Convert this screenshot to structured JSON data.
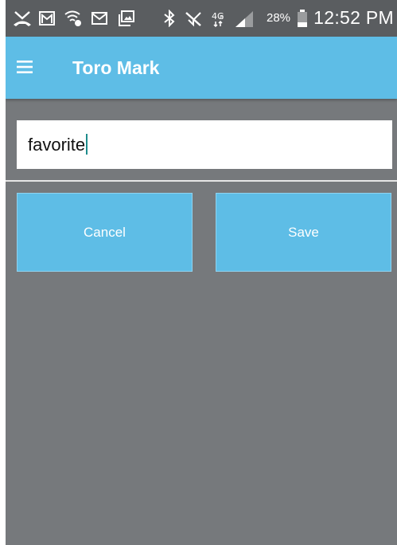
{
  "status_bar": {
    "icons": [
      "missed-call-icon",
      "gmail-icon",
      "wifi-calling-icon",
      "mail-icon",
      "photo-icon",
      "bluetooth-icon",
      "mute-icon",
      "4g-lte-icon",
      "signal-icon",
      "battery-icon"
    ],
    "battery_percent": "28%",
    "time": "12:52 PM"
  },
  "app_bar": {
    "menu_icon": "hamburger-menu-icon",
    "title": "Toro Mark",
    "color": "#5ebde6"
  },
  "form": {
    "input_value": "favorite",
    "cancel_label": "Cancel",
    "save_label": "Save"
  },
  "colors": {
    "background": "#76797c",
    "accent": "#5ebde6",
    "status_bar": "#5a5d60"
  }
}
